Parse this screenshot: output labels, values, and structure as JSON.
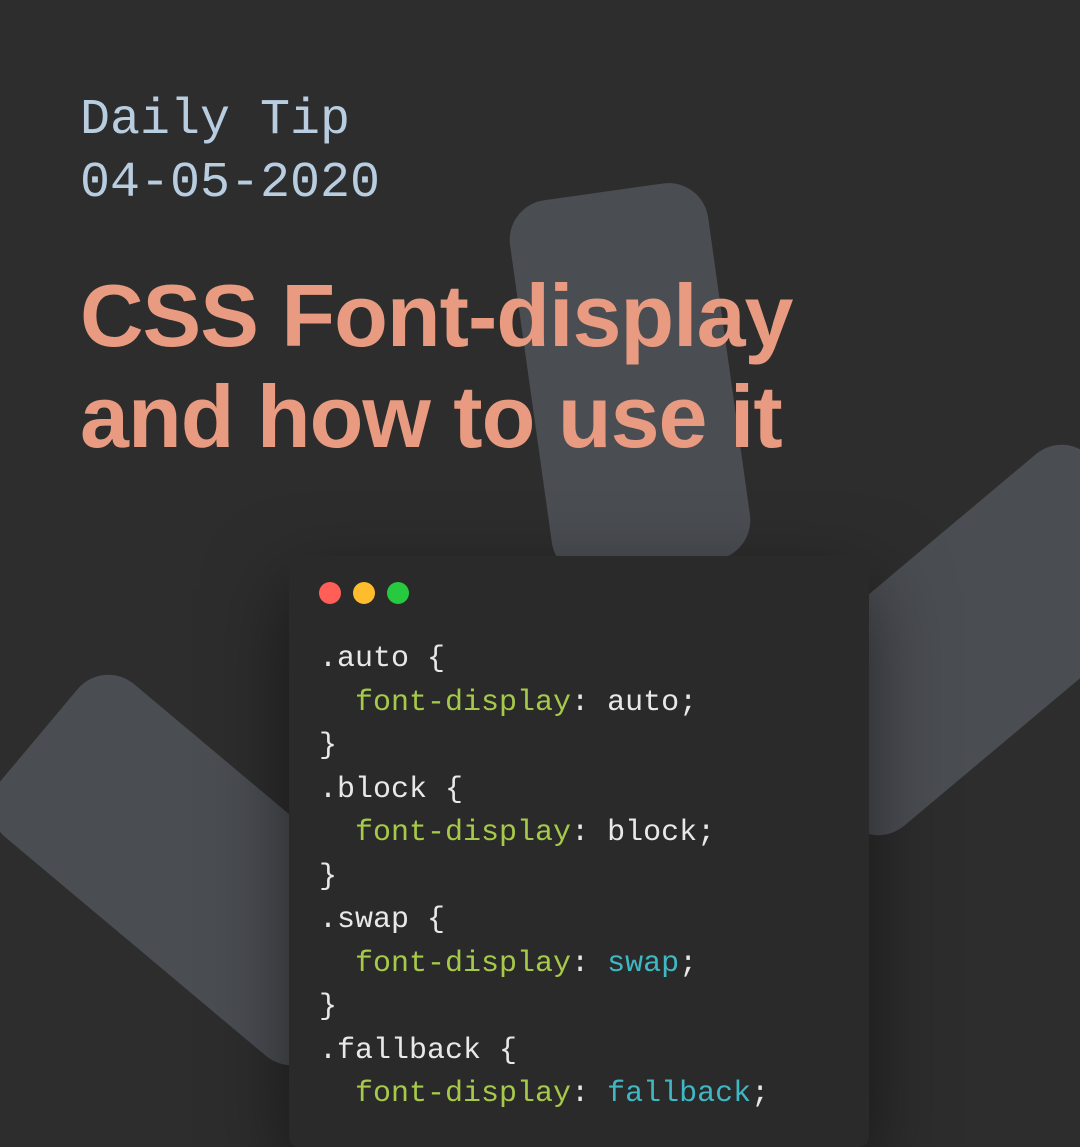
{
  "header": {
    "label": "Daily Tip",
    "date": "04-05-2020"
  },
  "title": {
    "line1": "CSS Font-display",
    "line2": "and how to use it"
  },
  "code": {
    "rules": [
      {
        "selector": ".auto",
        "property": "font-display",
        "value": "auto",
        "valueHighlight": false,
        "closed": true
      },
      {
        "selector": ".block",
        "property": "font-display",
        "value": "block",
        "valueHighlight": false,
        "closed": true
      },
      {
        "selector": ".swap",
        "property": "font-display",
        "value": "swap",
        "valueHighlight": true,
        "closed": true
      },
      {
        "selector": ".fallback",
        "property": "font-display",
        "value": "fallback",
        "valueHighlight": true,
        "closed": false
      }
    ]
  },
  "colors": {
    "background": "#2d2d2d",
    "headerText": "#b8cde0",
    "titleText": "#e89b80",
    "codeBase": "#e8e8e8",
    "codeProp": "#a6c94a",
    "codeKeyword": "#3fb7c4"
  }
}
